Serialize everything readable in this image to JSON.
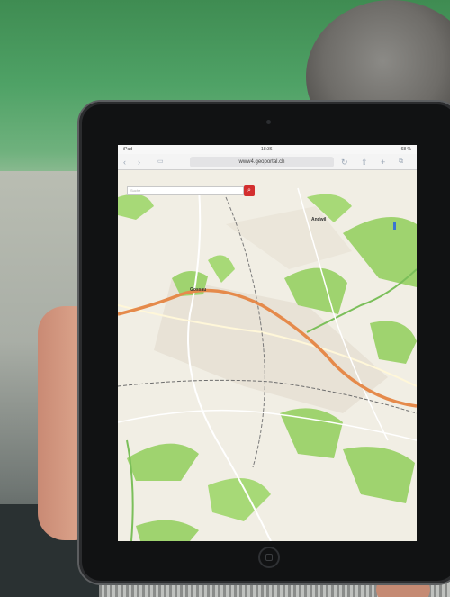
{
  "statusbar": {
    "left": "iPad",
    "time": "18:36",
    "right": "68 %"
  },
  "browser": {
    "url": "www4.geoportal.ch",
    "back_icon": "chevron-left-icon",
    "forward_icon": "chevron-right-icon",
    "bookmarks_icon": "book-icon",
    "reload_icon": "reload-icon",
    "share_icon": "share-icon",
    "add_icon": "plus-icon",
    "tabs_icon": "tabs-icon"
  },
  "map": {
    "search_placeholder": "Suche",
    "search_icon": "search-icon",
    "places": [
      {
        "name": "Andwil"
      },
      {
        "name": "Gossau"
      }
    ],
    "locate_icon": "target-icon"
  },
  "colors": {
    "accent": "#d32f2f",
    "forest": "#9fd36f",
    "highway": "#e58a4b",
    "map_base": "#f1eee4"
  }
}
